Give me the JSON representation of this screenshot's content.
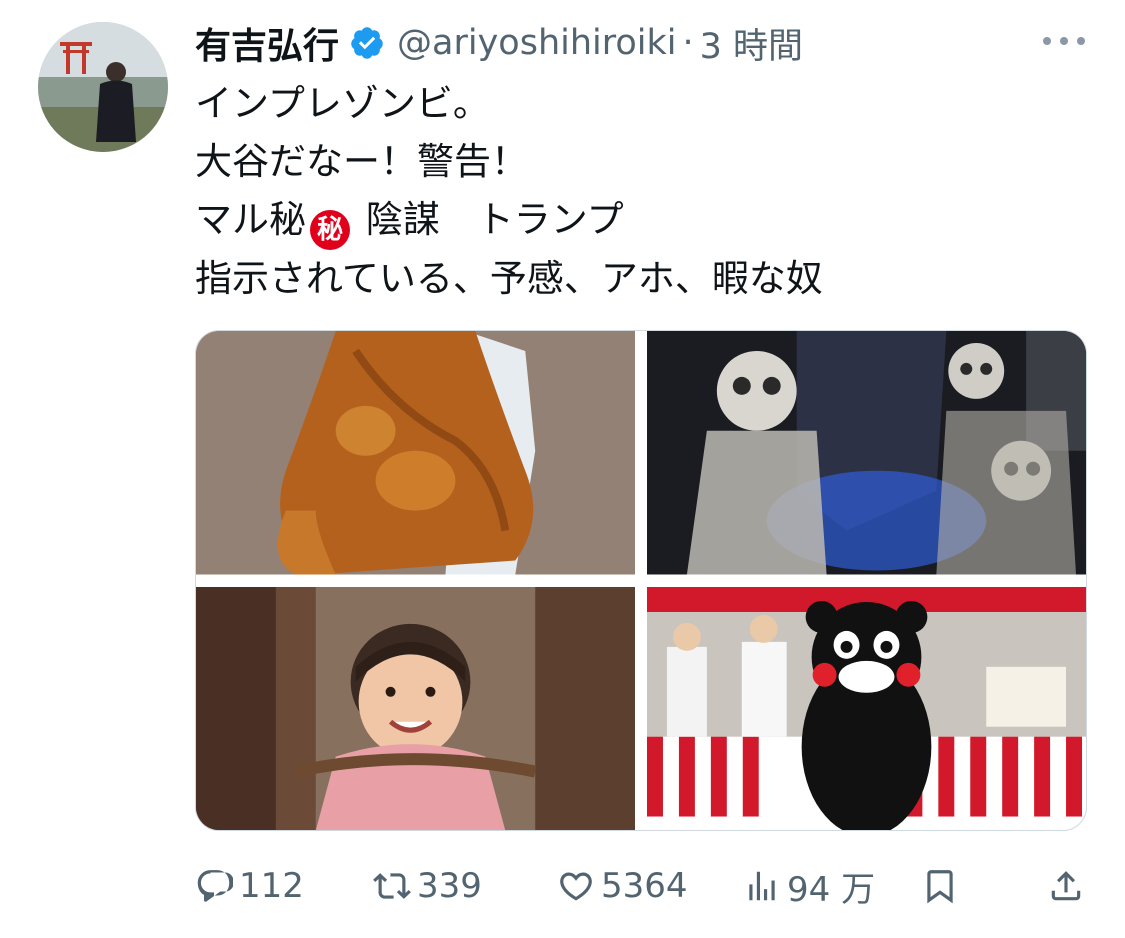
{
  "tweet": {
    "author": {
      "display_name": "有吉弘行",
      "handle": "@ariyoshihiroiki",
      "verified": true,
      "avatar_icon": "avatar-photo"
    },
    "separator": "·",
    "timestamp": "3 時間",
    "text_lines": {
      "line1": "インプレゾンビ。",
      "line2": "大谷だなー！警告！",
      "line3_before": "マル秘",
      "line3_emoji": "秘",
      "line3_after": " 陰謀　トランプ",
      "line4": "指示されている、予感、アホ、暇な奴"
    },
    "media": [
      {
        "name": "roast-duck-photo"
      },
      {
        "name": "skeletons-figure-photo"
      },
      {
        "name": "smiling-child-photo"
      },
      {
        "name": "kumamon-festival-photo"
      }
    ],
    "actions": {
      "reply_count": "112",
      "retweet_count": "339",
      "like_count": "5364",
      "views_count": "94 万"
    },
    "colors": {
      "verified_blue": "#1d9bf0",
      "secondary_text": "#536471",
      "primary_text": "#0f1419",
      "secret_red": "#e0001b"
    }
  }
}
